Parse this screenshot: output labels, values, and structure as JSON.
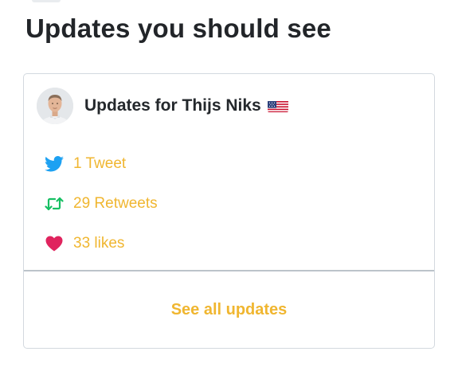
{
  "page": {
    "title": "Updates you should see"
  },
  "card": {
    "title": "Updates for Thijs Niks",
    "flag_icon": "us-flag-icon",
    "stats": [
      {
        "icon": "twitter-bird-icon",
        "label": "1 Tweet",
        "color": "#1da1f2"
      },
      {
        "icon": "retweet-icon",
        "label": "29 Retweets",
        "color": "#17bf63"
      },
      {
        "icon": "heart-icon",
        "label": "33 likes",
        "color": "#e0245e"
      }
    ],
    "footer_link": "See all updates"
  },
  "colors": {
    "accent": "#f0b630",
    "border": "#d3d9df",
    "text": "#222529"
  }
}
